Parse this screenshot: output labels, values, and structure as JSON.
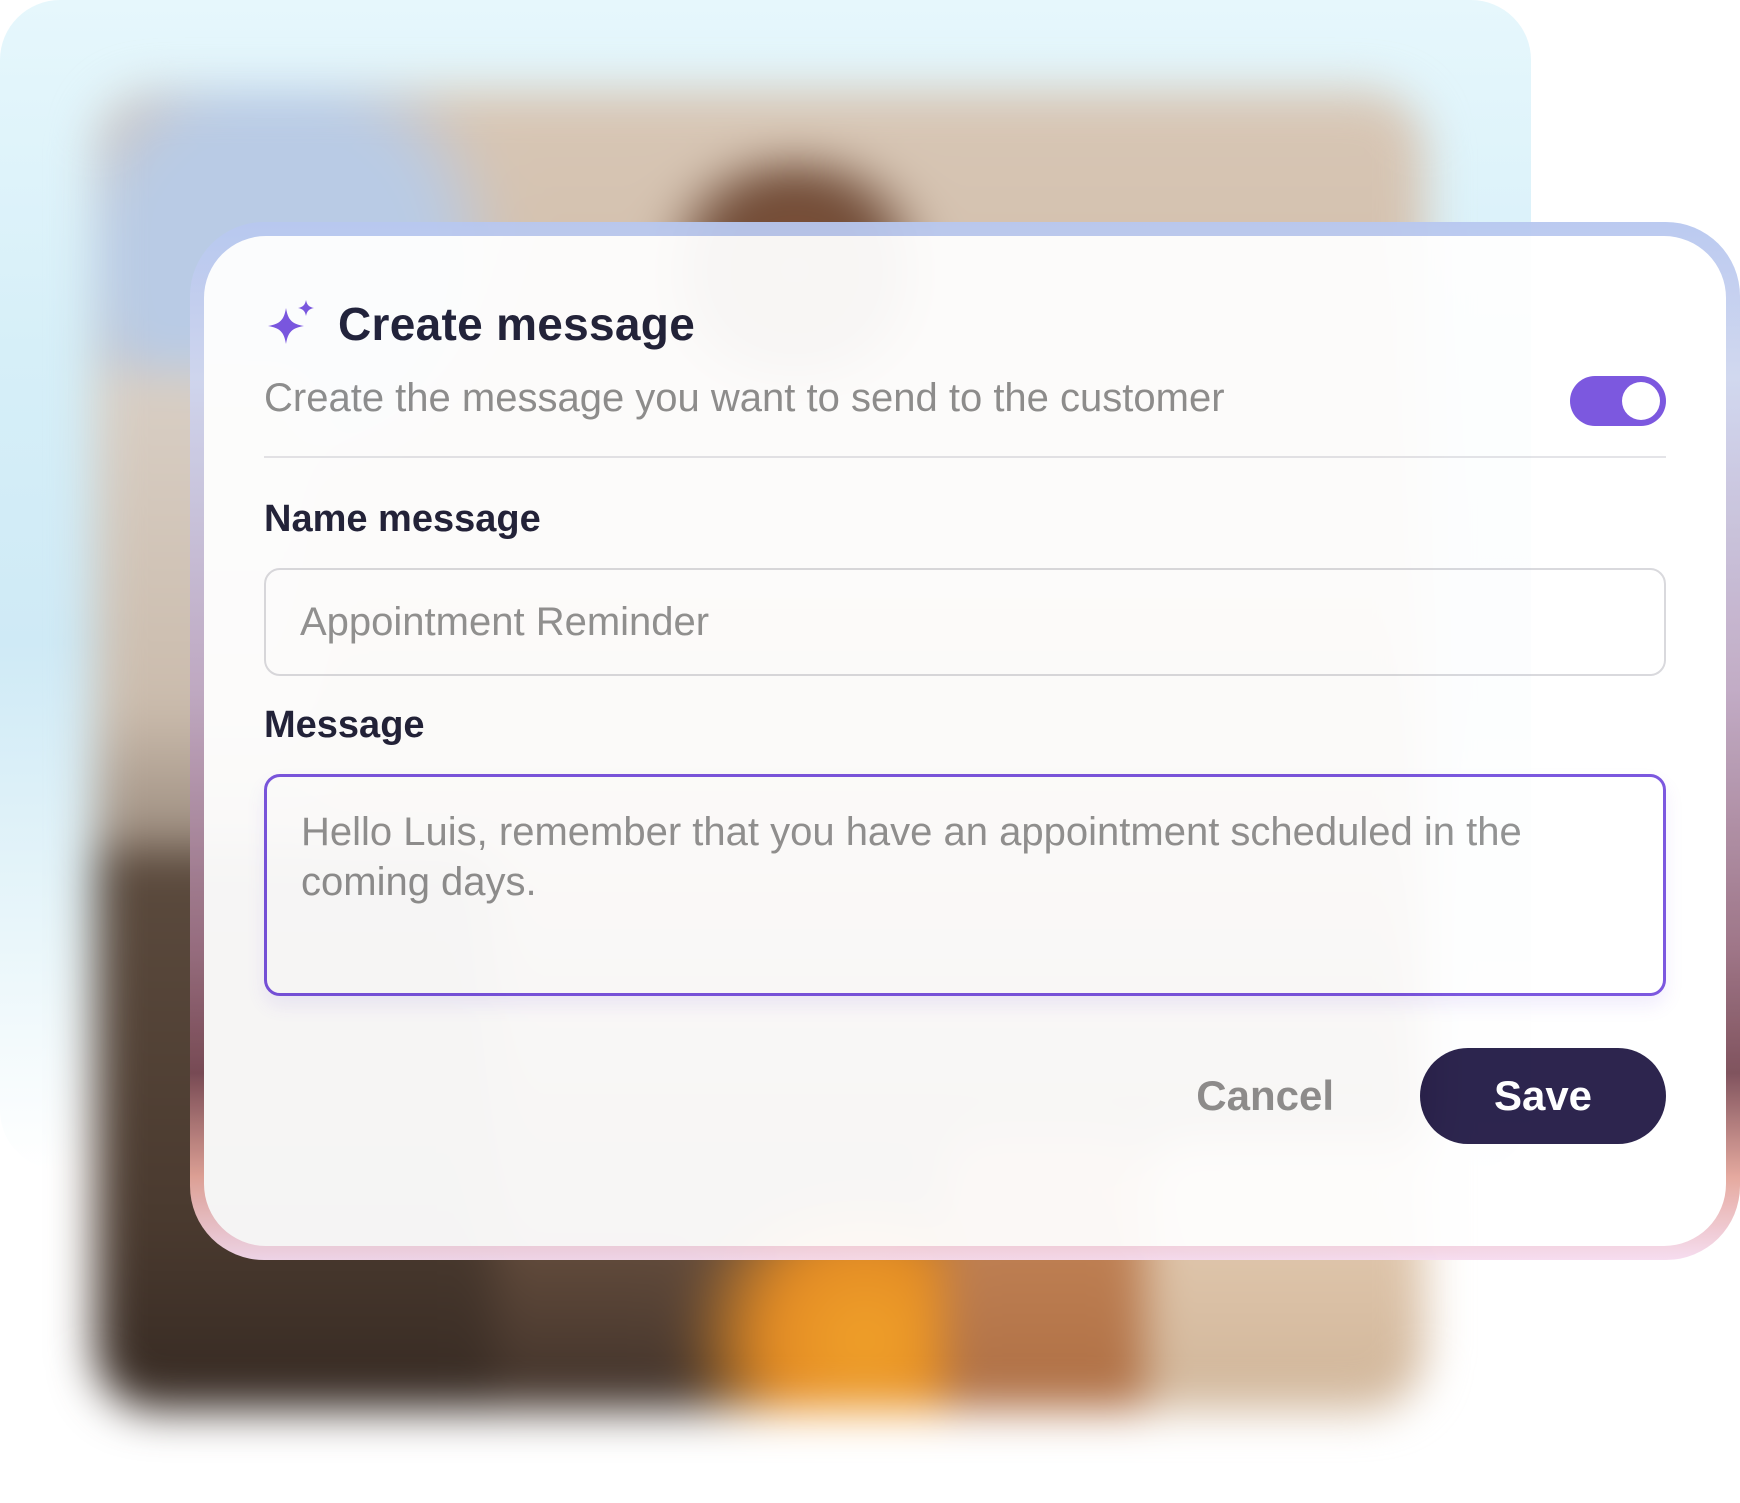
{
  "dialog": {
    "title": "Create message",
    "subtitle": "Create the message you want to send to the customer",
    "icon": "sparkle-icon",
    "toggle": {
      "state": "on"
    }
  },
  "fields": {
    "name_label": "Name message",
    "name_placeholder": "Appointment Reminder",
    "message_label": "Message",
    "message_placeholder": "Hello Luis, remember that you have an appointment scheduled in the coming days."
  },
  "actions": {
    "cancel_label": "Cancel",
    "save_label": "Save"
  },
  "colors": {
    "accent": "#7650de",
    "primary_button": "#221a45",
    "title_text": "#1a1b33",
    "muted_text": "#8e8e8e"
  }
}
